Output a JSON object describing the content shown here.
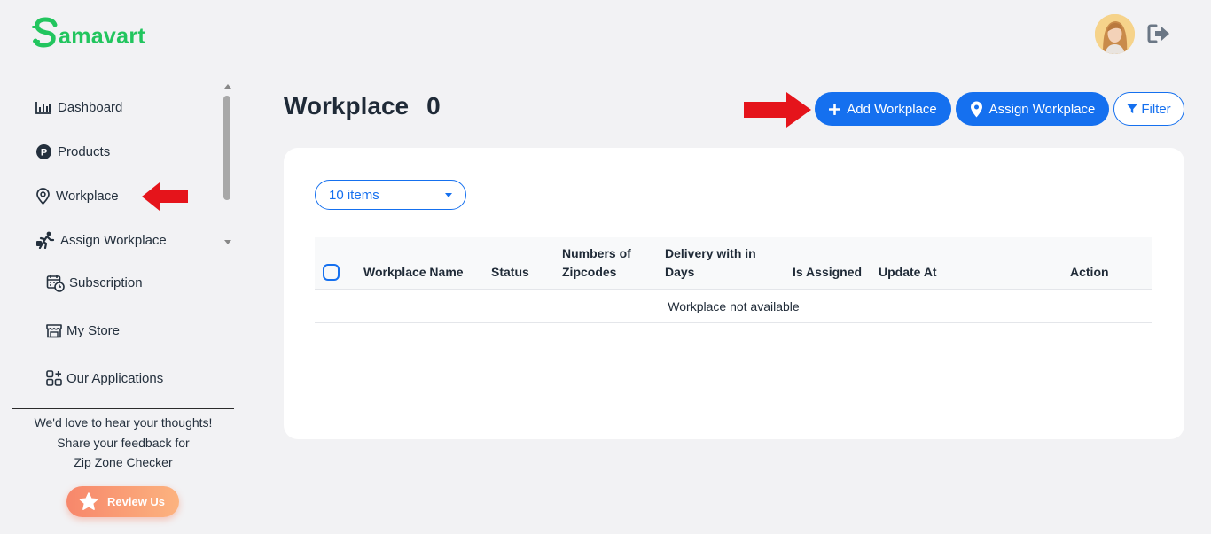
{
  "brand": {
    "name": "amavart",
    "logo_letter": "S",
    "color": "#22c55e"
  },
  "header": {
    "avatar": "user-avatar",
    "logout_icon": "logout-icon"
  },
  "sidebar": {
    "items": [
      {
        "label": "Dashboard",
        "icon": "bar-chart-icon"
      },
      {
        "label": "Products",
        "icon": "p-circle-icon"
      },
      {
        "label": "Workplace",
        "icon": "map-pin-icon"
      },
      {
        "label": "Assign Workplace",
        "icon": "delivery-runner-icon"
      }
    ],
    "secondary": [
      {
        "label": "Subscription",
        "icon": "calendar-clock-icon"
      },
      {
        "label": "My Store",
        "icon": "store-icon"
      },
      {
        "label": "Our Applications",
        "icon": "apps-grid-icon"
      }
    ],
    "feedback": {
      "line1": "We'd love to hear your thoughts!",
      "line2": "Share your feedback for",
      "line3": "Zip Zone Checker"
    },
    "review_label": "Review Us"
  },
  "main": {
    "title": "Workplace",
    "count": "0",
    "buttons": {
      "add": "Add Workplace",
      "assign": "Assign Workplace",
      "filter": "Filter"
    },
    "page_size": "10 items",
    "columns": [
      "Workplace Name",
      "Status",
      "Numbers of Zipcodes",
      "Delivery with in Days",
      "Is Assigned",
      "Update At",
      "Action"
    ],
    "empty_message": "Workplace not available"
  },
  "colors": {
    "accent": "#1570ef",
    "annotation_arrow": "#e5141b",
    "review_gradient_start": "#f7876b",
    "review_gradient_end": "#fcb37f"
  }
}
